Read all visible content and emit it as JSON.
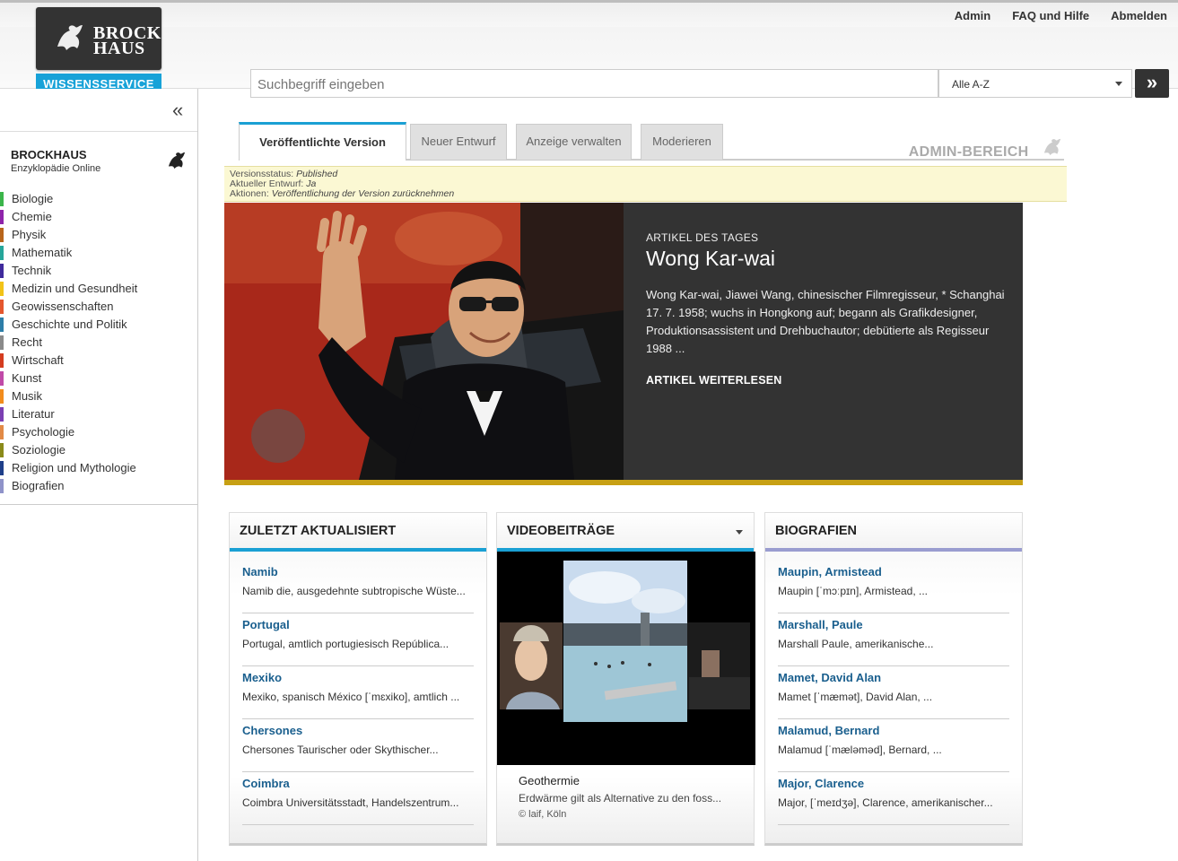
{
  "header": {
    "logo_text_line1": "BROCK",
    "logo_text_line2": "HAUS",
    "logo_sub": "WISSENSSERVICE",
    "links": [
      "Admin",
      "FAQ und Hilfe",
      "Abmelden"
    ],
    "search_placeholder": "Suchbegriff eingeben",
    "filter_selected": "Alle A-Z",
    "go_icon": "double-chevron-right-icon"
  },
  "sidebar": {
    "title": "BROCKHAUS",
    "subtitle": "Enzyklopädie Online",
    "categories": [
      {
        "label": "Biologie",
        "color": "#3bb54a"
      },
      {
        "label": "Chemie",
        "color": "#8e24aa"
      },
      {
        "label": "Physik",
        "color": "#b8651b"
      },
      {
        "label": "Mathematik",
        "color": "#26a69a"
      },
      {
        "label": "Technik",
        "color": "#3f2a9c"
      },
      {
        "label": "Medizin und Gesundheit",
        "color": "#f2c318"
      },
      {
        "label": "Geowissenschaften",
        "color": "#e4572e"
      },
      {
        "label": "Geschichte und Politik",
        "color": "#2d7ea8"
      },
      {
        "label": "Recht",
        "color": "#8a8a8a"
      },
      {
        "label": "Wirtschaft",
        "color": "#d43c1f"
      },
      {
        "label": "Kunst",
        "color": "#c04aa8"
      },
      {
        "label": "Musik",
        "color": "#f28c1c"
      },
      {
        "label": "Literatur",
        "color": "#7b3fb2"
      },
      {
        "label": "Psychologie",
        "color": "#e28a46"
      },
      {
        "label": "Soziologie",
        "color": "#8a8a1a"
      },
      {
        "label": "Religion und Mythologie",
        "color": "#1f3f8a"
      },
      {
        "label": "Biografien",
        "color": "#8f93c9"
      }
    ]
  },
  "tabs": [
    "Veröffentlichte Version",
    "Neuer Entwurf",
    "Anzeige verwalten",
    "Moderieren"
  ],
  "admin_label": "ADMIN-BEREICH",
  "status": {
    "version_label": "Versionsstatus:",
    "version_value": "Published",
    "draft_label": "Aktueller Entwurf:",
    "draft_value": "Ja",
    "actions_label": "Aktionen:",
    "actions_value": "Veröffentlichung der Version zurücknehmen"
  },
  "hero": {
    "kicker": "ARTIKEL DES TAGES",
    "title": "Wong Kar-wai",
    "body": "Wong Kar-wai, Jiawei Wang, chinesischer Filmregisseur, * Schanghai 17. 7. 1958; wuchs in Hongkong auf; begann als Grafikdesigner, Produktionsassistent und Drehbuchautor; debütierte als Regisseur 1988 ...",
    "link": "ARTIKEL WEITERLESEN"
  },
  "panels": {
    "recent": {
      "title": "ZULETZT AKTUALISIERT",
      "items": [
        {
          "title": "Namib",
          "snippet": "Namib die, ausgedehnte subtropische Wüste..."
        },
        {
          "title": "Portugal",
          "snippet": "Portugal, amtlich portugiesisch República..."
        },
        {
          "title": "Mexiko",
          "snippet": "Mexiko, spanisch México [ˈmɛxiko], amtlich ..."
        },
        {
          "title": "Chersones",
          "snippet": "Chersones Taurischer oder Skythischer..."
        },
        {
          "title": "Coimbra",
          "snippet": "Coimbra Universitätsstadt, Handelszentrum..."
        }
      ]
    },
    "video": {
      "title": "VIDEOBEITRÄGE",
      "caption_title": "Geothermie",
      "caption_text": "Erdwärme gilt als Alternative zu den foss...",
      "caption_credit": "© laif, Köln"
    },
    "bio": {
      "title": "BIOGRAFIEN",
      "accent": "#9a9dd0",
      "items": [
        {
          "title": "Maupin, Armistead",
          "snippet": "Maupin [ˈmɔːpɪn], Armistead, ..."
        },
        {
          "title": "Marshall, Paule",
          "snippet": "Marshall Paule, amerikanische..."
        },
        {
          "title": "Mamet, David Alan",
          "snippet": "Mamet [ˈmæmət], David Alan, ..."
        },
        {
          "title": "Malamud, Bernard",
          "snippet": "Malamud [ˈmæləməd], Bernard, ..."
        },
        {
          "title": "Major, Clarence",
          "snippet": "Major, [ˈmeɪdʒə], Clarence, amerikanischer..."
        }
      ]
    }
  }
}
